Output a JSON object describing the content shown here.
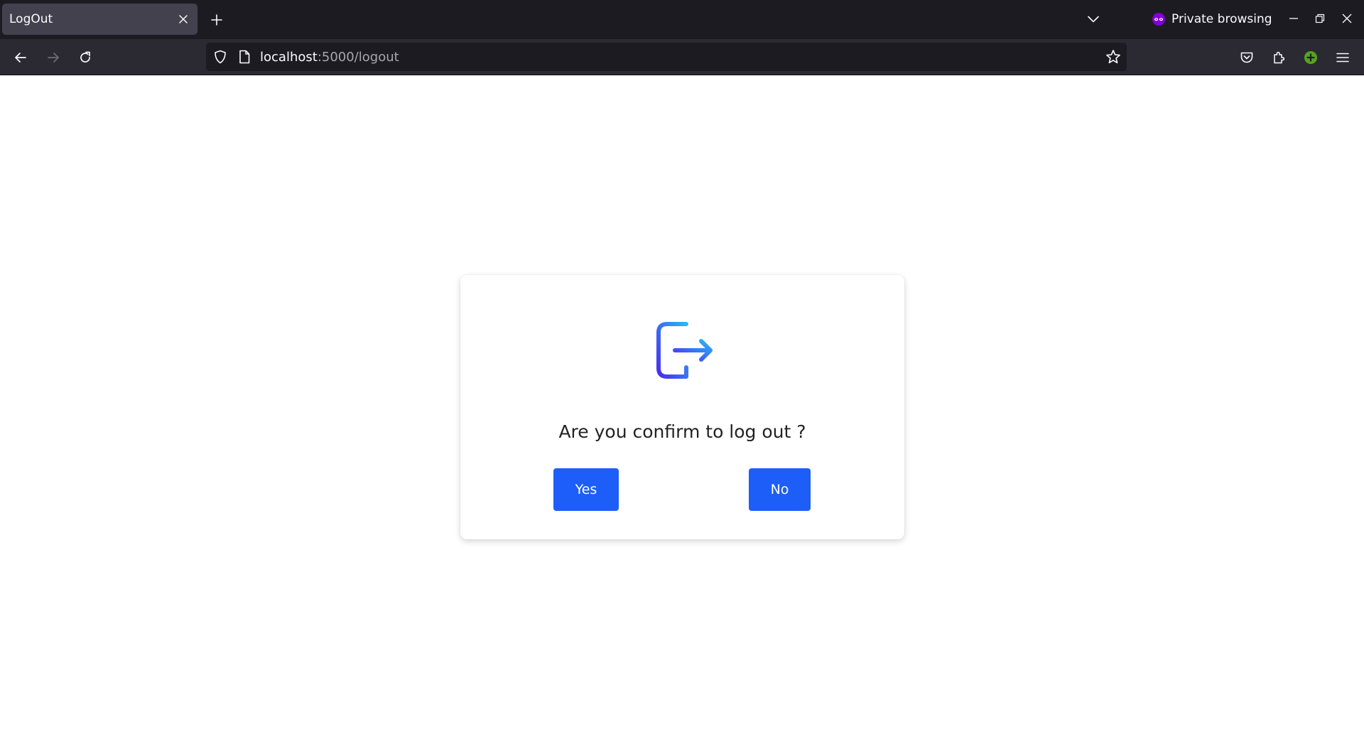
{
  "browser": {
    "tab": {
      "title": "LogOut"
    },
    "private_label": "Private browsing",
    "url": {
      "host": "localhost",
      "path": ":5000/logout"
    },
    "colors": {
      "tab_strip": "#1c1b22",
      "nav_bar": "#2b2a33",
      "active_tab": "#42414d",
      "private_icon": "#8000d7",
      "addon_icon": "#54a320"
    },
    "icons": {
      "tab_close": "close-icon",
      "new_tab": "plus-icon",
      "list_tabs": "chevron-down-icon",
      "private": "private-mask-icon",
      "back": "arrow-left-icon",
      "forward": "arrow-right-icon",
      "reload": "reload-icon",
      "shield": "shield-icon",
      "page": "page-icon",
      "bookmark": "star-icon",
      "pocket": "pocket-icon",
      "extensions": "puzzle-icon",
      "addon": "plus-circle-icon",
      "menu": "hamburger-menu-icon"
    }
  },
  "dialog": {
    "icon": "logout-icon",
    "message": "Are you confirm to log out ?",
    "yes_label": "Yes",
    "no_label": "No",
    "button_color": "#1e5ef8"
  }
}
